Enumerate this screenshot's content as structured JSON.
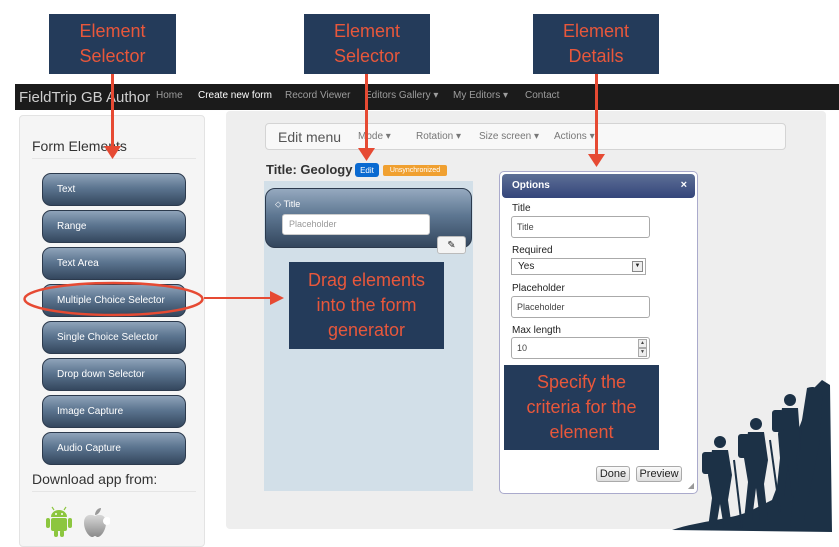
{
  "navbar": {
    "brand": "FieldTrip GB Author",
    "items": [
      {
        "label": "Home",
        "active": false
      },
      {
        "label": "Create new form",
        "active": true
      },
      {
        "label": "Record Viewer",
        "active": false
      },
      {
        "label": "Editors Gallery ▾",
        "active": false
      },
      {
        "label": "My Editors ▾",
        "active": false
      },
      {
        "label": "Contact",
        "active": false
      }
    ]
  },
  "sidebar": {
    "title": "Form Elements",
    "elements": [
      "Text",
      "Range",
      "Text Area",
      "Multiple Choice Selector",
      "Single Choice Selector",
      "Drop down Selector",
      "Image Capture",
      "Audio Capture"
    ],
    "download_title": "Download app from:",
    "download_icons": [
      "android-icon",
      "apple-icon"
    ]
  },
  "edit_menu": {
    "title": "Edit menu",
    "items": [
      "Mode ▾",
      "Rotation ▾",
      "Size screen ▾",
      "Actions ▾"
    ]
  },
  "form": {
    "title": "Title: Geology",
    "edit_badge": "Edit",
    "unsync_badge": "Unsynchronized",
    "field_label": "⬦ Title",
    "field_placeholder": "Placeholder",
    "pencil": "✎"
  },
  "options": {
    "title": "Options",
    "close": "×",
    "title_label": "Title",
    "title_value": "Title",
    "required_label": "Required",
    "required_value": "Yes",
    "placeholder_label": "Placeholder",
    "placeholder_value": "Placeholder",
    "maxlength_label": "Max length",
    "maxlength_value": "10",
    "done_button": "Done",
    "preview_button": "Preview"
  },
  "annotations": {
    "element_selector_1": "Element\nSelector",
    "element_selector_2": "Element\nSelector",
    "element_details": "Element\nDetails",
    "drag_note": "Drag elements\ninto the form\ngenerator",
    "criteria_note": "Specify the\ncriteria for the\nelement"
  },
  "colors": {
    "callout_bg": "#243b5a",
    "callout_text": "#e8573b",
    "arrow": "#e64a33",
    "navbar_bg": "#1b1b1b",
    "form_area_bg": "#d2dfe8",
    "edit_badge": "#0a6ad1",
    "unsync_badge": "#f0a030"
  }
}
